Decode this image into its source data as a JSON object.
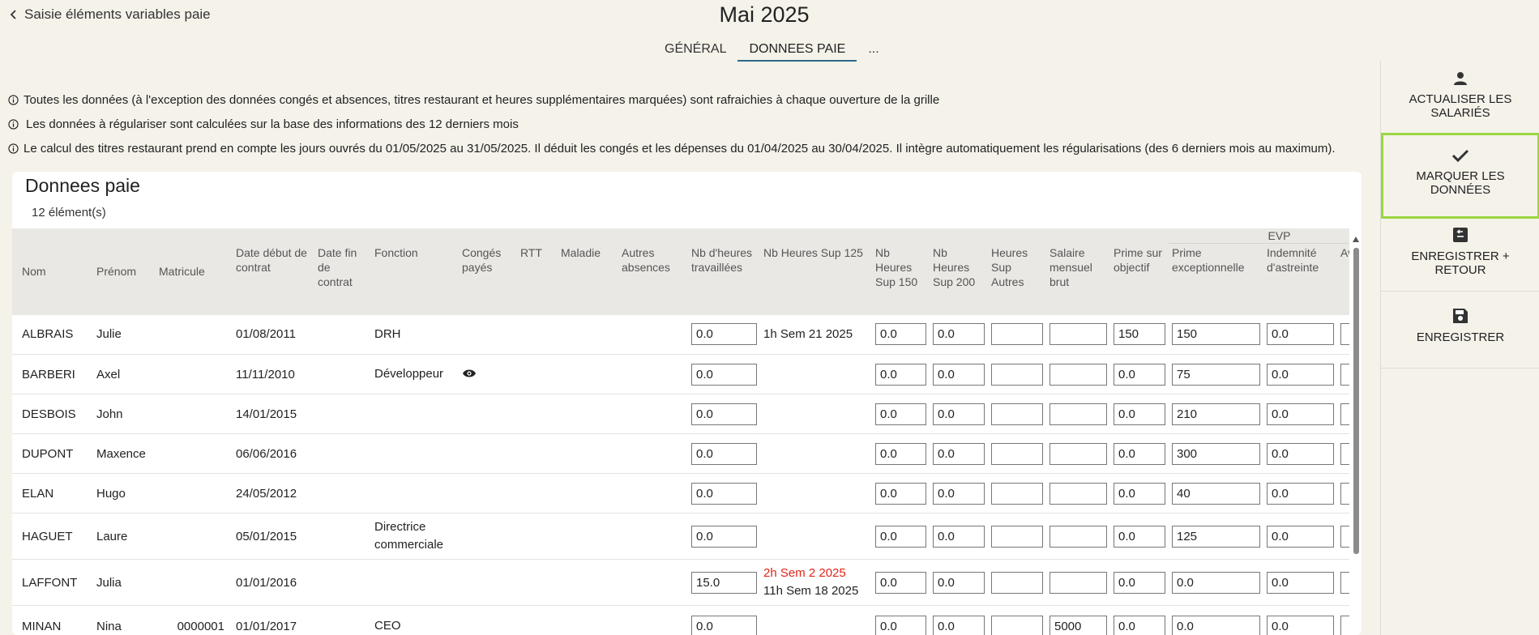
{
  "header": {
    "back_label": "Saisie éléments variables paie",
    "title": "Mai 2025",
    "tabs": [
      {
        "label": "GÉNÉRAL"
      },
      {
        "label": "DONNEES PAIE"
      },
      {
        "label": "..."
      }
    ],
    "active_tab": "DONNEES PAIE"
  },
  "info_lines": [
    "Toutes les données (à l'exception des données congés et absences, titres restaurant et heures supplémentaires marquées) sont rafraichies à chaque ouverture de la grille",
    "Les données à régulariser sont calculées sur la base des informations des 12 derniers mois",
    "Le calcul des titres restaurant prend en compte les jours ouvrés du 01/05/2025 au 31/05/2025. Il déduit les congés et les dépenses du 01/04/2025 au 30/04/2025. Il intègre automatiquement les régularisations (des 6 derniers mois au maximum)."
  ],
  "card": {
    "title": "Donnees paie",
    "count": "12 élément(s)"
  },
  "table": {
    "group_header": "EVP",
    "columns": {
      "nom": "Nom",
      "prenom": "Prénom",
      "matricule": "Matricule",
      "date_debut": "Date début de contrat",
      "date_fin": "Date fin de contrat",
      "fonction": "Fonction",
      "conges": "Congés payés",
      "rtt": "RTT",
      "maladie": "Maladie",
      "autres_absences": "Autres absences",
      "nb_heures": "Nb d'heures travaillées",
      "hs125": "Nb Heures Sup 125",
      "hs150": "Nb Heures Sup 150",
      "hs200": "Nb Heures Sup 200",
      "hs_autres": "Heures Sup Autres",
      "salaire": "Salaire mensuel brut",
      "prime_obj": "Prime sur objectif",
      "prime_exc": "Prime exceptionnelle",
      "astreinte": "Indemnité d'astreinte",
      "avantage": "Av en vo"
    },
    "rows": [
      {
        "nom": "ALBRAIS",
        "prenom": "Julie",
        "matricule": "",
        "date_debut": "01/08/2011",
        "date_fin": "",
        "fonction": "DRH",
        "conges_icon": "",
        "nb_heures": "0.0",
        "hs125": [
          "1h Sem 21 2025"
        ],
        "hs125_red": [],
        "hs150": "0.0",
        "hs200": "0.0",
        "hs_autres": "",
        "salaire": "",
        "prime_obj": "150",
        "prime_exc": "150",
        "astreinte": "0.0"
      },
      {
        "nom": "BARBERI",
        "prenom": "Axel",
        "matricule": "",
        "date_debut": "11/11/2010",
        "date_fin": "",
        "fonction": "Développeur",
        "conges_icon": "eye-icon",
        "nb_heures": "0.0",
        "hs125": [],
        "hs125_red": [],
        "hs150": "0.0",
        "hs200": "0.0",
        "hs_autres": "",
        "salaire": "",
        "prime_obj": "0.0",
        "prime_exc": "75",
        "astreinte": "0.0"
      },
      {
        "nom": "DESBOIS",
        "prenom": "John",
        "matricule": "",
        "date_debut": "14/01/2015",
        "date_fin": "",
        "fonction": "",
        "conges_icon": "",
        "nb_heures": "0.0",
        "hs125": [],
        "hs125_red": [],
        "hs150": "0.0",
        "hs200": "0.0",
        "hs_autres": "",
        "salaire": "",
        "prime_obj": "0.0",
        "prime_exc": "210",
        "astreinte": "0.0"
      },
      {
        "nom": "DUPONT",
        "prenom": "Maxence",
        "matricule": "",
        "date_debut": "06/06/2016",
        "date_fin": "",
        "fonction": "",
        "conges_icon": "",
        "nb_heures": "0.0",
        "hs125": [],
        "hs125_red": [],
        "hs150": "0.0",
        "hs200": "0.0",
        "hs_autres": "",
        "salaire": "",
        "prime_obj": "0.0",
        "prime_exc": "300",
        "astreinte": "0.0"
      },
      {
        "nom": "ELAN",
        "prenom": "Hugo",
        "matricule": "",
        "date_debut": "24/05/2012",
        "date_fin": "",
        "fonction": "",
        "conges_icon": "",
        "nb_heures": "0.0",
        "hs125": [],
        "hs125_red": [],
        "hs150": "0.0",
        "hs200": "0.0",
        "hs_autres": "",
        "salaire": "",
        "prime_obj": "0.0",
        "prime_exc": "40",
        "astreinte": "0.0"
      },
      {
        "nom": "HAGUET",
        "prenom": "Laure",
        "matricule": "",
        "date_debut": "05/01/2015",
        "date_fin": "",
        "fonction": "Directrice commerciale",
        "conges_icon": "",
        "nb_heures": "0.0",
        "hs125": [],
        "hs125_red": [],
        "hs150": "0.0",
        "hs200": "0.0",
        "hs_autres": "",
        "salaire": "",
        "prime_obj": "0.0",
        "prime_exc": "125",
        "astreinte": "0.0"
      },
      {
        "nom": "LAFFONT",
        "prenom": "Julia",
        "matricule": "",
        "date_debut": "01/01/2016",
        "date_fin": "",
        "fonction": "",
        "conges_icon": "",
        "nb_heures": "15.0",
        "hs125": [
          "11h Sem 18 2025"
        ],
        "hs125_red": [
          "2h Sem 2 2025"
        ],
        "hs150": "0.0",
        "hs200": "0.0",
        "hs_autres": "",
        "salaire": "",
        "prime_obj": "0.0",
        "prime_exc": "0.0",
        "astreinte": "0.0"
      },
      {
        "nom": "MINAN",
        "prenom": "Nina",
        "matricule": "0000001",
        "date_debut": "01/01/2017",
        "date_fin": "",
        "fonction": "CEO",
        "conges_icon": "",
        "nb_heures": "0.0",
        "hs125": [],
        "hs125_red": [],
        "hs150": "0.0",
        "hs200": "0.0",
        "hs_autres": "",
        "salaire": "5000",
        "prime_obj": "0.0",
        "prime_exc": "0.0",
        "astreinte": "0.0"
      }
    ]
  },
  "sidebar": {
    "actions": [
      {
        "label": "ACTUALISER LES SALARIÉS",
        "icon": "person-icon"
      },
      {
        "label": "MARQUER LES DONNÉES",
        "icon": "check-icon"
      },
      {
        "label": "ENREGISTRER + RETOUR",
        "icon": "save-return-icon"
      },
      {
        "label": "ENREGISTRER",
        "icon": "save-icon"
      }
    ],
    "highlight_color": "#99d640"
  }
}
